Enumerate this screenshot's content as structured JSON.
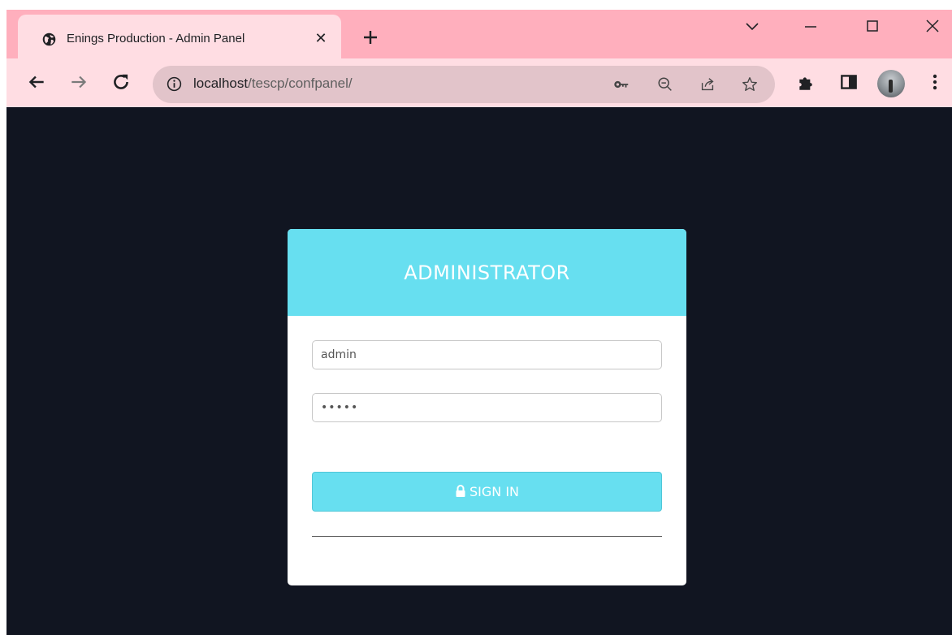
{
  "browser": {
    "tab": {
      "title": "Enings Production - Admin Panel",
      "close_glyph": "✕",
      "icon": "globe-icon"
    },
    "new_tab_icon": "plus-icon",
    "window_controls": [
      "tab-search-icon",
      "minimize-icon",
      "maximize-icon",
      "close-icon"
    ],
    "toolbar": {
      "back_icon": "back-arrow-icon",
      "forward_icon": "forward-arrow-icon",
      "reload_icon": "reload-icon",
      "address": {
        "host": "localhost",
        "path": "/tescp/confpanel/",
        "site_info_icon": "info-icon"
      },
      "omnibox_icons": [
        "key-icon",
        "zoom-out-icon",
        "share-icon",
        "star-icon"
      ],
      "right_icons": [
        "extensions-icon",
        "side-panel-icon",
        "avatar",
        "menu-icon"
      ]
    },
    "colors": {
      "tabstrip": "#ffafbd",
      "toolbar": "#ffdde3",
      "omnibox": "#e2c4ca"
    }
  },
  "page": {
    "background": "#111521",
    "login": {
      "heading": "ADMINISTRATOR",
      "username_value": "admin",
      "password_value": "•••••",
      "sign_in_label": "SIGN IN",
      "sign_in_icon": "lock-icon",
      "accent_color": "#67dff0"
    }
  }
}
